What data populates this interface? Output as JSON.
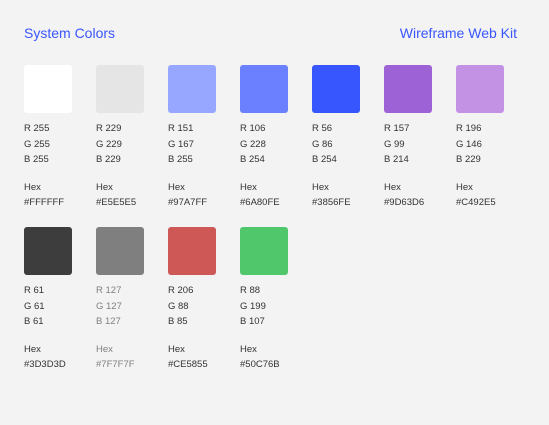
{
  "header": {
    "title": "System Colors",
    "kit": "Wireframe Web Kit"
  },
  "hex_label": "Hex",
  "swatches": [
    {
      "r": "R 255",
      "g": "G 255",
      "b": "B 255",
      "hex": "#FFFFFF",
      "color": "#FFFFFF"
    },
    {
      "r": "R 229",
      "g": "G 229",
      "b": "B 229",
      "hex": "#E5E5E5",
      "color": "#E5E5E5"
    },
    {
      "r": "R 151",
      "g": "G 167",
      "b": "B 255",
      "hex": "#97A7FF",
      "color": "#97A7FF"
    },
    {
      "r": "R 106",
      "g": "G 228",
      "b": "B 254",
      "hex": "#6A80FE",
      "color": "#6A80FE"
    },
    {
      "r": "R 56",
      "g": "G 86",
      "b": "B 254",
      "hex": "#3856FE",
      "color": "#3856FE"
    },
    {
      "r": "R 157",
      "g": "G 99",
      "b": "B 214",
      "hex": "#9D63D6",
      "color": "#9D63D6"
    },
    {
      "r": "R 196",
      "g": "G 146",
      "b": "B 229",
      "hex": "#C492E5",
      "color": "#C492E5"
    },
    {
      "r": "R 61",
      "g": "G 61",
      "b": "B 61",
      "hex": "#3D3D3D",
      "color": "#3D3D3D"
    },
    {
      "r": "R 127",
      "g": "G 127",
      "b": "B 127",
      "hex": "#7F7F7F",
      "color": "#7F7F7F"
    },
    {
      "r": "R 206",
      "g": "G 88",
      "b": "B 85",
      "hex": "#CE5855",
      "color": "#CE5855"
    },
    {
      "r": "R 88",
      "g": "G 199",
      "b": "B 107",
      "hex": "#50C76B",
      "color": "#50C76B"
    }
  ]
}
